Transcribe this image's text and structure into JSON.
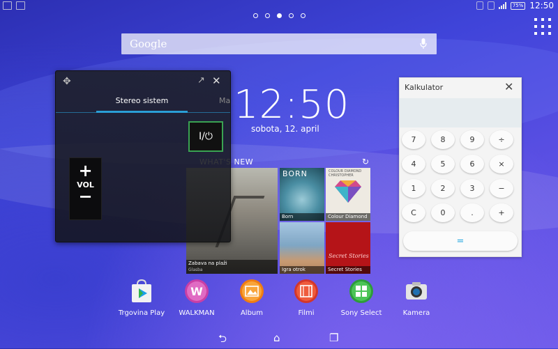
{
  "status_bar": {
    "time": "12:50",
    "battery": "75%"
  },
  "search": {
    "label": "Google"
  },
  "clock": {
    "time": "12:50",
    "date": "sobota, 12. april"
  },
  "whats_new": {
    "title": "WHAT'S NEW",
    "tiles": [
      {
        "title": "Zabava na plaži",
        "subtitle": "Glasba"
      },
      {
        "title": "Born",
        "cover_text": "BORN"
      },
      {
        "title": "Colour Diamond",
        "cover_text": "COLOUR DIAMOND CHRISTOPHER"
      },
      {
        "title": "Igra otrok"
      },
      {
        "title": "Secret Stories",
        "cover_text": "Secret Stories"
      }
    ]
  },
  "stereo_widget": {
    "tabs": [
      {
        "label": "Stereo sistem"
      },
      {
        "label": "Ma"
      }
    ],
    "power_label": "I/⏻",
    "vol_plus": "+",
    "vol_label": "VOL",
    "vol_minus": "−"
  },
  "calculator": {
    "title": "Kalkulator",
    "keys": [
      "7",
      "8",
      "9",
      "÷",
      "4",
      "5",
      "6",
      "×",
      "1",
      "2",
      "3",
      "−",
      "C",
      "0",
      ".",
      "+"
    ],
    "equals": "="
  },
  "dock": [
    {
      "label": "Trgovina Play",
      "icon": "play-store-icon"
    },
    {
      "label": "WALKMAN",
      "icon": "walkman-icon"
    },
    {
      "label": "Album",
      "icon": "album-icon"
    },
    {
      "label": "Filmi",
      "icon": "movies-icon"
    },
    {
      "label": "Sony Select",
      "icon": "sony-select-icon"
    },
    {
      "label": "Kamera",
      "icon": "camera-icon"
    }
  ],
  "colors": {
    "accent_blue": "#2a9fd6",
    "power_green": "#3aa352"
  }
}
